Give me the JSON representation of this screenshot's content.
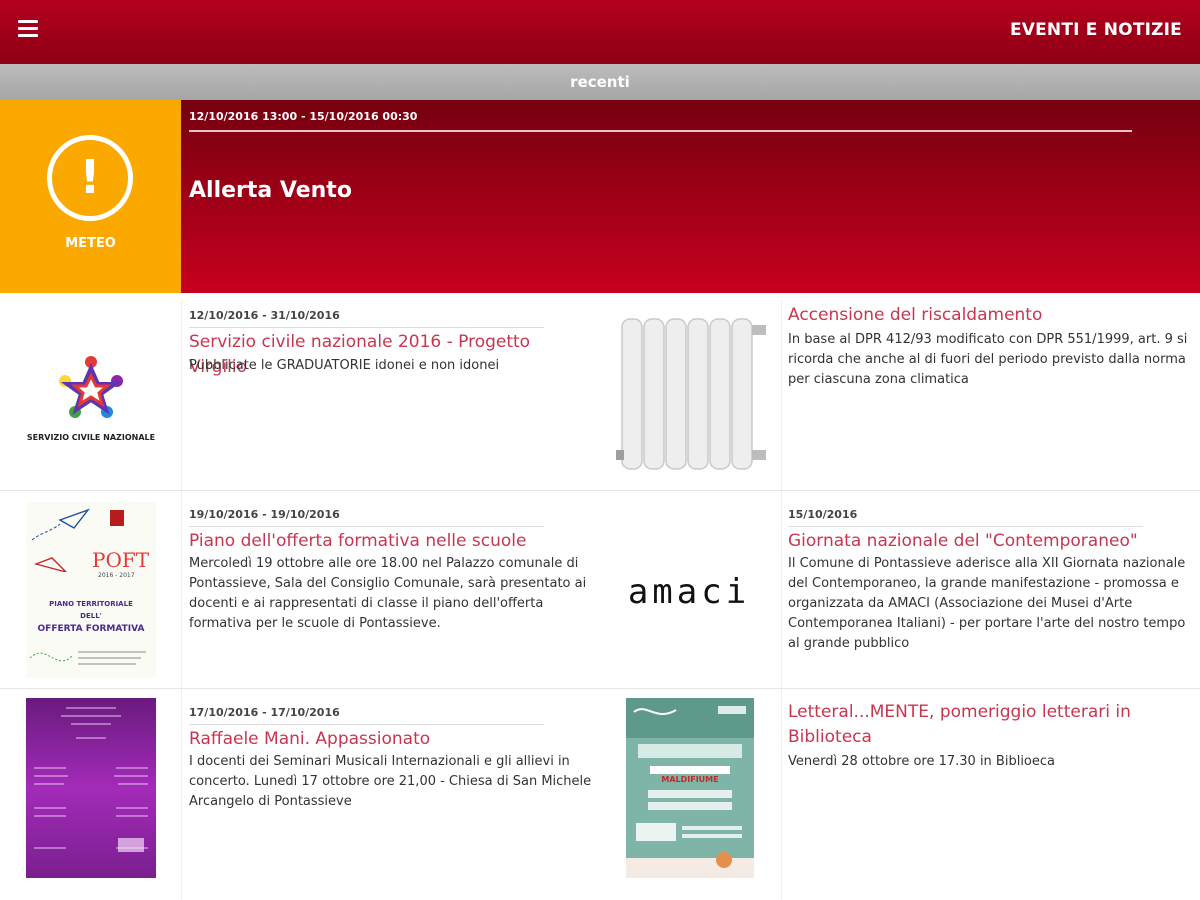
{
  "header": {
    "title": "EVENTI E NOTIZIE",
    "menu_icon": "hamburger-icon"
  },
  "section": {
    "label": "recenti"
  },
  "alert": {
    "category": "METEO",
    "icon": "exclamation-icon",
    "date": "12/10/2016 13:00 - 15/10/2016 00:30",
    "title": "Allerta Vento",
    "colors": {
      "category_bg": "#fba800",
      "body_bg": "#a80018"
    }
  },
  "news": [
    {
      "date": "12/10/2016 - 31/10/2016",
      "title": "Servizio civile nazionale 2016 - Progetto Virgilio",
      "description": "Pubblicate le GRADUATORIE idonei e non idonei",
      "image_label": "SERVIZIO CIVILE NAZIONALE"
    },
    {
      "date": "",
      "title": "Accensione del riscaldamento",
      "description": "In base al DPR 412/93 modificato con DPR 551/1999, art. 9 si ricorda che anche al di fuori del periodo previsto dalla norma per ciascuna zona climatica",
      "image_label": ""
    },
    {
      "date": "19/10/2016 - 19/10/2016",
      "title": "Piano dell'offerta formativa nelle scuole",
      "description": "Mercoledì 19 ottobre alle ore 18.00 nel Palazzo comunale di Pontassieve, Sala del Consiglio Comunale, sarà presentato ai docenti e ai rappresentati di classe il piano dell'offerta formativa per le scuole di Pontassieve.",
      "image_label": "POFT",
      "image_sub": "2016 - 2017",
      "image_text1": "PIANO TERRITORIALE",
      "image_text2": "DELL'",
      "image_text3": "OFFERTA FORMATIVA"
    },
    {
      "date": "15/10/2016",
      "title": "Giornata nazionale del \"Contemporaneo\"",
      "description": "Il Comune di Pontassieve aderisce alla XII Giornata nazionale del Contemporaneo, la grande manifestazione - promossa e organizzata da AMACI (Associazione dei Musei d'Arte Contemporanea Italiani) - per portare l'arte del nostro tempo al grande pubblico",
      "image_label": "AMACI"
    },
    {
      "date": "17/10/2016 - 17/10/2016",
      "title": "Raffaele Mani. Appassionato",
      "description": "I docenti dei Seminari Musicali Internazionali e gli allievi in concerto. Lunedì 17 ottobre ore 21,00 - Chiesa di San Michele Arcangelo di Pontassieve",
      "image_label": ""
    },
    {
      "date": "",
      "title": "Letteral...MENTE, pomeriggio letterari in Biblioteca",
      "description": "Venerdì 28 ottobre ore 17.30 in Biblioeca",
      "image_label": "MALDIFIUME"
    }
  ]
}
